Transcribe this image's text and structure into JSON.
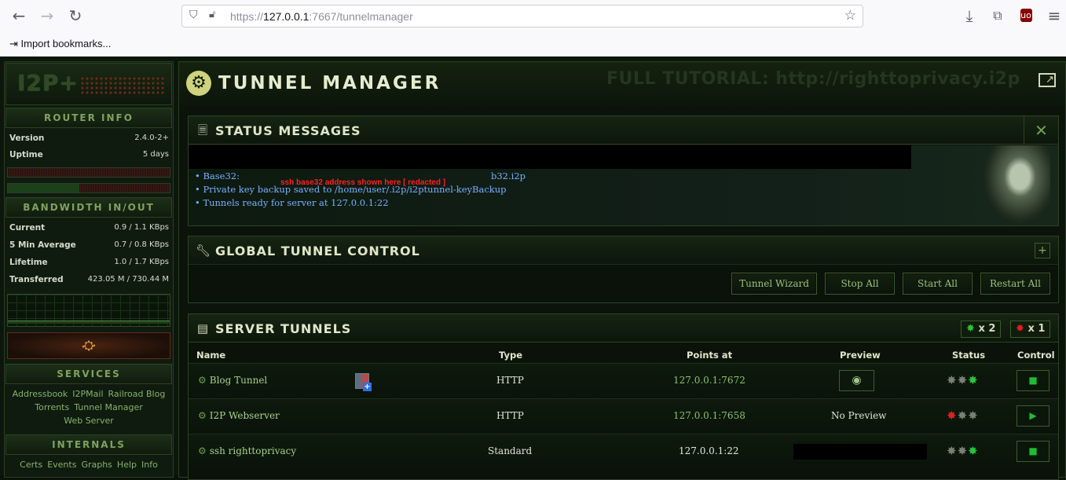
{
  "browser": {
    "url_prefix": "https://",
    "url_host": "127.0.0.1",
    "url_rest": ":7667/tunnelmanager",
    "bookmarks_item": "Import bookmarks..."
  },
  "sidebar": {
    "logo": "I2P+",
    "router_info": {
      "heading": "ROUTER INFO",
      "version_label": "Version",
      "version_value": "2.4.0-2+",
      "uptime_label": "Uptime",
      "uptime_value": "5 days"
    },
    "bandwidth": {
      "heading": "BANDWIDTH IN/OUT",
      "rows": [
        {
          "label": "Current",
          "value": "0.9 / 1.1 KBps"
        },
        {
          "label": "5 Min Average",
          "value": "0.7 / 0.8 KBps"
        },
        {
          "label": "Lifetime",
          "value": "1.0 / 1.7 KBps"
        },
        {
          "label": "Transferred",
          "value": "423.05 M / 730.44 M"
        }
      ]
    },
    "services": {
      "heading": "SERVICES",
      "links": [
        "Addressbook",
        "I2PMail",
        "Railroad Blog",
        "Torrents",
        "Tunnel Manager",
        "Web Server"
      ]
    },
    "internals": {
      "heading": "INTERNALS",
      "links": [
        "Certs",
        "Events",
        "Graphs",
        "Help",
        "Info"
      ]
    }
  },
  "main": {
    "title": "TUNNEL MANAGER",
    "watermark": "FULL TUTORIAL:  http://righttoprivacy.i2p",
    "status": {
      "heading": "STATUS MESSAGES",
      "base32_label": "• Base32:",
      "redacted_note": "ssh base32 address shown here [ redacted ]",
      "b32_suffix": "b32.i2p",
      "line2": "• Private key backup saved to /home/user/.i2p/i2ptunnel-keyBackup",
      "line3": "• Tunnels ready for server at 127.0.0.1:22"
    },
    "global": {
      "heading": "GLOBAL TUNNEL CONTROL",
      "buttons": [
        "Tunnel Wizard",
        "Stop All",
        "Start All",
        "Restart All"
      ]
    },
    "server": {
      "heading": "SERVER TUNNELS",
      "running_count": "x 2",
      "stopped_count": "x 1",
      "columns": [
        "Name",
        "Type",
        "Points at",
        "Preview",
        "Status",
        "Control"
      ],
      "rows": [
        {
          "name": "Blog Tunnel",
          "type": "HTTP",
          "points_at": "127.0.0.1:7672",
          "preview": "",
          "control": "stop"
        },
        {
          "name": "I2P Webserver",
          "type": "HTTP",
          "points_at": "127.0.0.1:7658",
          "preview": "No Preview",
          "control": "start"
        },
        {
          "name": "ssh righttoprivacy",
          "type": "Standard",
          "points_at": "127.0.0.1:22",
          "preview": "",
          "control": "stop"
        }
      ]
    }
  },
  "colors": {
    "accent": "#8bc26c",
    "running": "#29c43c",
    "stopped": "#e02121",
    "message": "#7ab0ff"
  }
}
